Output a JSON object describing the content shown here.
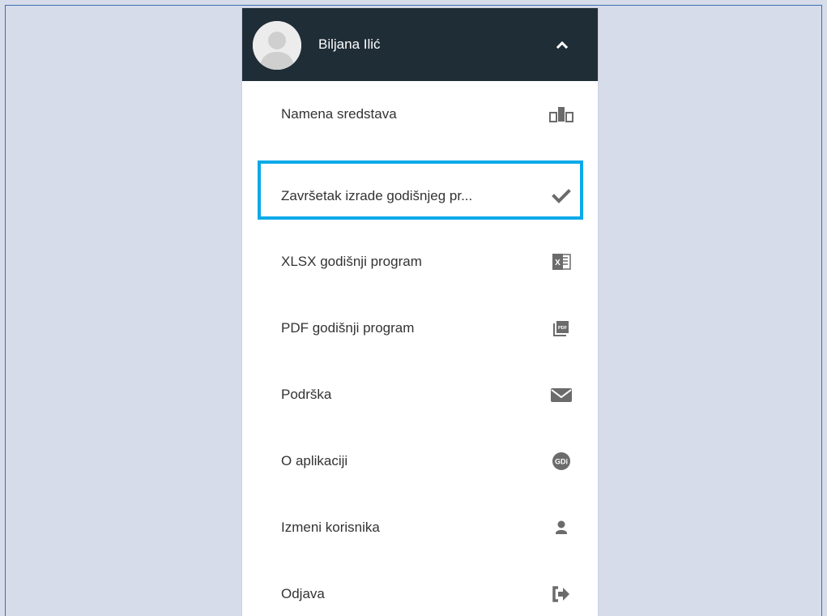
{
  "user": {
    "name": "Biljana Ilić"
  },
  "menu": {
    "toggle_icon": "chevron-up-icon",
    "items": [
      {
        "label": "Namena sredstava",
        "icon": "bar-chart-icon"
      },
      {
        "label": "Završetak izrade godišnjeg pr...",
        "icon": "checkmark-icon",
        "selected": true
      },
      {
        "label": "XLSX godišnji program",
        "icon": "excel-icon"
      },
      {
        "label": "PDF godišnji program",
        "icon": "pdf-icon"
      },
      {
        "label": "Podrška",
        "icon": "envelope-icon"
      },
      {
        "label": "O aplikaciji",
        "icon": "gdi-logo-icon",
        "icon_text": "GDi"
      },
      {
        "label": "Izmeni korisnika",
        "icon": "user-icon"
      },
      {
        "label": "Odjava",
        "icon": "sign-out-icon"
      }
    ]
  },
  "colors": {
    "background": "#d6dcea",
    "header": "#1f2d37",
    "selection": "#0aaae8",
    "icon": "#6b6b6b"
  }
}
